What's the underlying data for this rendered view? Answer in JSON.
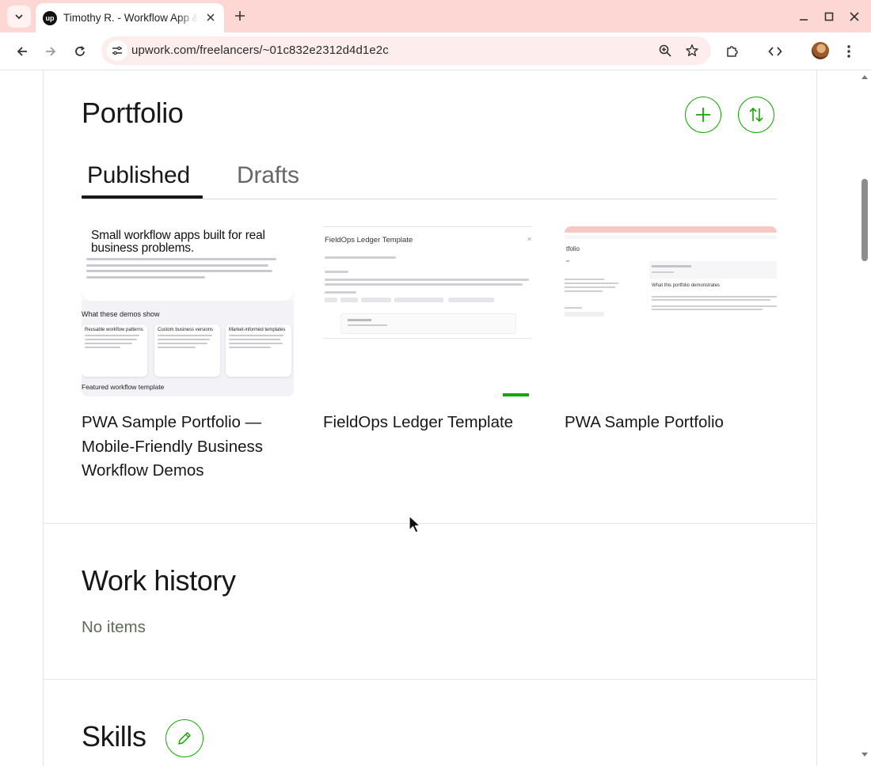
{
  "browser": {
    "tab_title": "Timothy R. - Workflow App & PWA Developer",
    "favicon_text": "up",
    "url": "upwork.com/freelancers/~01c832e2312d4d1e2c"
  },
  "portfolio": {
    "heading": "Portfolio",
    "tabs": [
      {
        "label": "Published",
        "active": true
      },
      {
        "label": "Drafts",
        "active": false
      }
    ],
    "items": [
      {
        "title": "PWA Sample Portfolio — Mobile-Friendly Business Workflow Demos",
        "thumb_heading": "Small workflow apps built for real business problems.",
        "thumb_subheading": "What these demos show",
        "thumb_cards": [
          "Reusable workflow patterns",
          "Custom business versions",
          "Market-informed templates"
        ],
        "thumb_footer": "Featured workflow template"
      },
      {
        "title": "FieldOps Ledger Template",
        "thumb_heading": "FieldOps Ledger Template"
      },
      {
        "title": "PWA Sample Portfolio",
        "thumb_heading": "tfolio",
        "thumb_subheading": "What this portfolio demonstrates"
      }
    ]
  },
  "work_history": {
    "heading": "Work history",
    "empty_text": "No items"
  },
  "skills": {
    "heading": "Skills"
  },
  "colors": {
    "accent_green": "#14a800",
    "chrome_pink": "#fdd7d3"
  }
}
